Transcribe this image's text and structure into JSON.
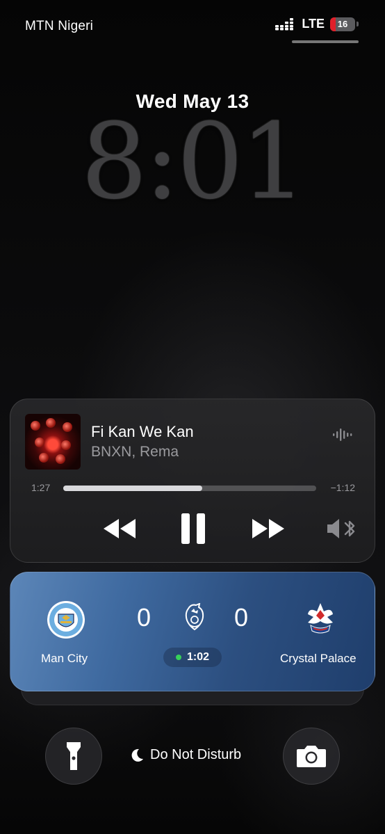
{
  "status_bar": {
    "carrier": "MTN Nigeri",
    "network": "LTE",
    "battery_level": "16",
    "battery_color": "#e0202a"
  },
  "lock_screen": {
    "date": "Wed May 13",
    "time": "8:01"
  },
  "now_playing": {
    "title": "Fi Kan We Kan",
    "artist": "BNXN, Rema",
    "elapsed": "1:27",
    "remaining": "−1:12",
    "progress_fraction": 0.55,
    "icons": [
      "waveform-icon",
      "rewind-icon",
      "pause-icon",
      "fast-forward-icon",
      "speaker-bluetooth-icon"
    ]
  },
  "live_score": {
    "home_team": "Man City",
    "away_team": "Crystal Palace",
    "home_score": "0",
    "away_score": "0",
    "match_clock": "1:02",
    "live_color": "#37d159",
    "icons": [
      "man-city-crest-icon",
      "premier-league-icon",
      "crystal-palace-crest-icon"
    ]
  },
  "bottom_bar": {
    "focus_mode": "Do Not Disturb",
    "icons": [
      "flashlight-icon",
      "moon-icon",
      "camera-icon"
    ]
  }
}
